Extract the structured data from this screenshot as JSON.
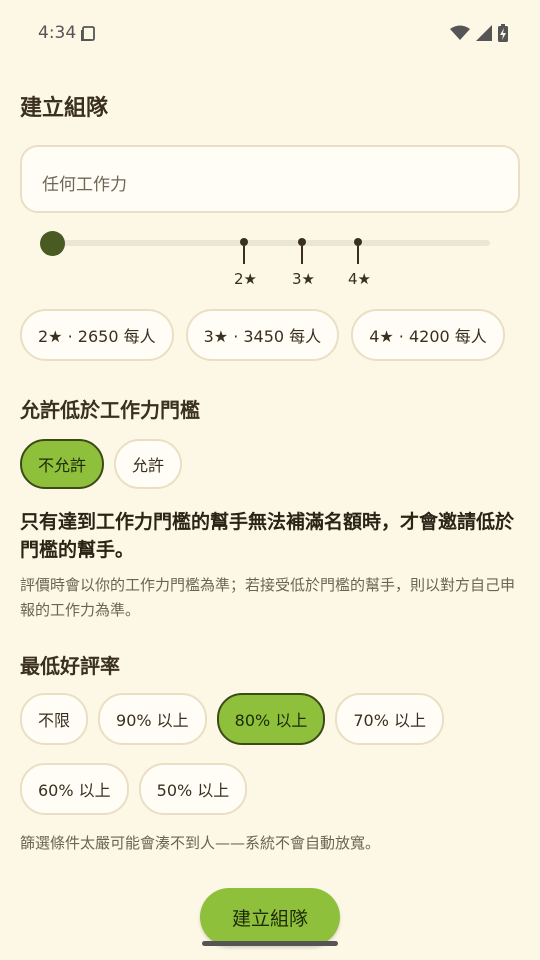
{
  "status_bar": {
    "time": "4:34",
    "icons": [
      "clipboard-icon",
      "wifi-icon",
      "signal-icon",
      "battery-charging-icon"
    ]
  },
  "page": {
    "title": "建立組隊"
  },
  "workforce_field": {
    "placeholder": "任何工作力"
  },
  "slider": {
    "value_fraction": 0,
    "ticks": [
      {
        "label": "2★",
        "position_fraction": 0.46
      },
      {
        "label": "3★",
        "position_fraction": 0.585
      },
      {
        "label": "4★",
        "position_fraction": 0.71
      }
    ]
  },
  "price_chips": [
    {
      "label": "2★ · 2650 每人"
    },
    {
      "label": "3★ · 3450 每人"
    },
    {
      "label": "4★ · 4200 每人"
    }
  ],
  "below_threshold": {
    "title": "允許低於工作力門檻",
    "options": [
      {
        "label": "不允許",
        "selected": true
      },
      {
        "label": "允許",
        "selected": false
      }
    ],
    "emphasis": "只有達到工作力門檻的幫手無法補滿名額時，才會邀請低於門檻的幫手。",
    "hint": "評價時會以你的工作力門檻為準；若接受低於門檻的幫手，則以對方自己申報的工作力為準。"
  },
  "min_rating": {
    "title": "最低好評率",
    "options": [
      {
        "label": "不限",
        "selected": false
      },
      {
        "label": "90% 以上",
        "selected": false
      },
      {
        "label": "80% 以上",
        "selected": true
      },
      {
        "label": "70% 以上",
        "selected": false
      },
      {
        "label": "60% 以上",
        "selected": false
      },
      {
        "label": "50% 以上",
        "selected": false
      }
    ],
    "footnote": "篩選條件太嚴可能會湊不到人——系統不會自動放寬。"
  },
  "create_button": {
    "label": "建立組隊"
  },
  "colors": {
    "background": "#fdf7e6",
    "accent": "#8fc03c",
    "accent_border": "#3b4a17",
    "slider_thumb": "#4a5a23"
  }
}
